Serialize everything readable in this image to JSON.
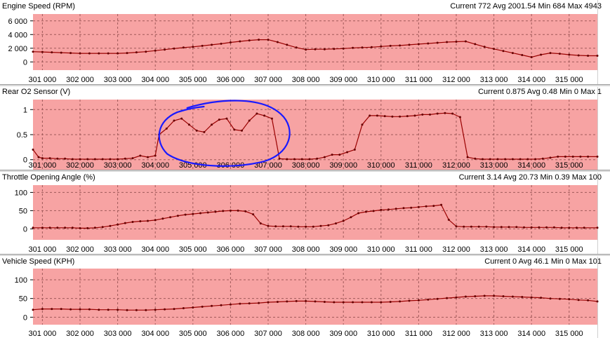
{
  "panels": [
    {
      "title": "Engine Speed (RPM)",
      "stats": "Current 772 Avg 2001.54 Min 684 Max 4943"
    },
    {
      "title": "Rear O2 Sensor (V)",
      "stats": "Current 0.875 Avg 0.48 Min 0 Max 1"
    },
    {
      "title": "Throttle Opening Angle (%)",
      "stats": "Current 3.14 Avg 20.73 Min 0.39 Max 100"
    },
    {
      "title": "Vehicle Speed (KPH)",
      "stats": "Current 0 Avg 46.1 Min 0 Max 101"
    }
  ],
  "colors": {
    "plot_background": "#f7a3a3",
    "line": "#990000",
    "marker": "#660000",
    "grid": "#a05a5a",
    "annotation": "#1a1aff"
  },
  "chart_data": [
    {
      "type": "line",
      "title": "Engine Speed (RPM)",
      "xlim": [
        300750,
        315750
      ],
      "ylim": [
        -1200,
        7000
      ],
      "y_ticks": [
        0,
        2000,
        4000,
        6000
      ],
      "y_tick_labels": [
        "0",
        "2 000",
        "4 000",
        "6 000"
      ],
      "x_ticks": [
        301000,
        302000,
        303000,
        304000,
        305000,
        306000,
        307000,
        308000,
        309000,
        310000,
        311000,
        312000,
        313000,
        314000,
        315000
      ],
      "x_tick_labels": [
        "301 000",
        "302 000",
        "303 000",
        "304 000",
        "305 000",
        "306 000",
        "307 000",
        "308 000",
        "309 000",
        "310 000",
        "311 000",
        "312 000",
        "313 000",
        "314 000",
        "315 000"
      ],
      "grid": true,
      "series": [
        {
          "x": [
            300750,
            301000,
            301250,
            301500,
            301750,
            302000,
            302250,
            302500,
            302750,
            303000,
            303250,
            303500,
            303750,
            304000,
            304250,
            304500,
            304750,
            305000,
            305250,
            305500,
            305750,
            306000,
            306250,
            306500,
            306750,
            307000,
            307250,
            307500,
            307750,
            308000,
            308250,
            308500,
            308750,
            309000,
            309250,
            309500,
            309750,
            310000,
            310250,
            310500,
            310750,
            311000,
            311250,
            311500,
            311750,
            312000,
            312250,
            312500,
            312750,
            313000,
            313250,
            313500,
            313750,
            314000,
            314250,
            314500,
            314750,
            315000,
            315250,
            315500,
            315750
          ],
          "y": [
            1500,
            1450,
            1400,
            1350,
            1300,
            1250,
            1250,
            1250,
            1250,
            1250,
            1300,
            1400,
            1500,
            1650,
            1800,
            1950,
            2100,
            2200,
            2350,
            2500,
            2650,
            2850,
            3000,
            3150,
            3250,
            3250,
            2900,
            2500,
            2100,
            1800,
            1850,
            1850,
            1900,
            1950,
            2050,
            2100,
            2150,
            2250,
            2350,
            2400,
            2500,
            2600,
            2700,
            2800,
            2900,
            2950,
            3000,
            2600,
            2200,
            1900,
            1600,
            1300,
            1000,
            700,
            1050,
            1300,
            1200,
            1050,
            950,
            900,
            900
          ]
        }
      ]
    },
    {
      "type": "line",
      "title": "Rear O2 Sensor (V)",
      "xlim": [
        300750,
        315750
      ],
      "ylim": [
        -0.2,
        1.2
      ],
      "y_ticks": [
        0,
        0.5,
        1
      ],
      "y_tick_labels": [
        "0",
        "0.5",
        "1"
      ],
      "x_ticks": [
        301000,
        302000,
        303000,
        304000,
        305000,
        306000,
        307000,
        308000,
        309000,
        310000,
        311000,
        312000,
        313000,
        314000,
        315000
      ],
      "x_tick_labels": [
        "301 000",
        "302 000",
        "303 000",
        "304 000",
        "305 000",
        "306 000",
        "307 000",
        "308 000",
        "309 000",
        "310 000",
        "311 000",
        "312 000",
        "313 000",
        "314 000",
        "315 000"
      ],
      "grid": true,
      "series": [
        {
          "x": [
            300750,
            300900,
            301000,
            301200,
            301400,
            301600,
            301800,
            302000,
            302200,
            302400,
            302600,
            302800,
            303000,
            303200,
            303400,
            303600,
            303800,
            304000,
            304100,
            304300,
            304500,
            304700,
            304900,
            305100,
            305300,
            305500,
            305700,
            305900,
            306100,
            306300,
            306500,
            306700,
            306900,
            307100,
            307300,
            307500,
            307700,
            307900,
            308100,
            308300,
            308500,
            308700,
            308900,
            309100,
            309300,
            309500,
            309700,
            309900,
            310100,
            310300,
            310500,
            310700,
            310900,
            311100,
            311300,
            311500,
            311700,
            311900,
            312100,
            312300,
            312500,
            312700,
            312900,
            313100,
            313300,
            313500,
            313700,
            313900,
            314100,
            314300,
            314500,
            314700,
            314900,
            315100,
            315300,
            315500,
            315750
          ],
          "y": [
            0.2,
            0.05,
            0.03,
            0.03,
            0.02,
            0.02,
            0.01,
            0.01,
            0.01,
            0.01,
            0.01,
            0.01,
            0.01,
            0.02,
            0.03,
            0.08,
            0.05,
            0.08,
            0.5,
            0.62,
            0.78,
            0.82,
            0.7,
            0.58,
            0.55,
            0.7,
            0.8,
            0.82,
            0.6,
            0.58,
            0.78,
            0.92,
            0.88,
            0.82,
            0.02,
            0.01,
            0.01,
            0.01,
            0.01,
            0.02,
            0.05,
            0.1,
            0.1,
            0.15,
            0.2,
            0.7,
            0.88,
            0.88,
            0.87,
            0.86,
            0.86,
            0.87,
            0.88,
            0.9,
            0.9,
            0.92,
            0.93,
            0.92,
            0.85,
            0.05,
            0.02,
            0.01,
            0.01,
            0.01,
            0.01,
            0.01,
            0.01,
            0.01,
            0.01,
            0.02,
            0.04,
            0.06,
            0.06,
            0.06,
            0.06,
            0.06,
            0.06
          ]
        }
      ],
      "annotations": [
        {
          "shape": "hand-drawn ellipse",
          "x_range": [
            304050,
            307600
          ],
          "y_range": [
            -0.15,
            1.18
          ]
        }
      ]
    },
    {
      "type": "line",
      "title": "Throttle Opening Angle (%)",
      "xlim": [
        300750,
        315750
      ],
      "ylim": [
        -30,
        120
      ],
      "y_ticks": [
        0,
        50,
        100
      ],
      "y_tick_labels": [
        "0",
        "50",
        "100"
      ],
      "x_ticks": [
        301000,
        302000,
        303000,
        304000,
        305000,
        306000,
        307000,
        308000,
        309000,
        310000,
        311000,
        312000,
        313000,
        314000,
        315000
      ],
      "x_tick_labels": [
        "301 000",
        "302 000",
        "303 000",
        "304 000",
        "305 000",
        "306 000",
        "307 000",
        "308 000",
        "309 000",
        "310 000",
        "311 000",
        "312 000",
        "313 000",
        "314 000",
        "315 000"
      ],
      "grid": true,
      "series": [
        {
          "x": [
            300750,
            301000,
            301200,
            301400,
            301600,
            301800,
            302000,
            302200,
            302400,
            302600,
            302800,
            303000,
            303200,
            303400,
            303600,
            303800,
            304000,
            304200,
            304400,
            304600,
            304800,
            305000,
            305200,
            305400,
            305600,
            305800,
            306000,
            306200,
            306400,
            306600,
            306800,
            307000,
            307200,
            307400,
            307600,
            307800,
            308000,
            308200,
            308400,
            308600,
            308800,
            309000,
            309200,
            309400,
            309600,
            309800,
            310000,
            310200,
            310400,
            310600,
            310800,
            311000,
            311200,
            311400,
            311600,
            311800,
            312000,
            312200,
            312400,
            312600,
            312800,
            313000,
            313200,
            313400,
            313600,
            313800,
            314000,
            314200,
            314400,
            314600,
            314800,
            315000,
            315200,
            315400,
            315750
          ],
          "y": [
            3,
            3,
            3,
            3,
            3,
            3,
            2,
            2,
            3,
            5,
            8,
            12,
            16,
            19,
            21,
            22,
            24,
            28,
            32,
            36,
            39,
            41,
            43,
            45,
            47,
            49,
            50,
            50,
            48,
            40,
            15,
            8,
            7,
            7,
            7,
            6,
            6,
            6,
            8,
            10,
            15,
            22,
            32,
            43,
            47,
            49,
            52,
            53,
            55,
            57,
            58,
            60,
            62,
            63,
            66,
            25,
            7,
            6,
            6,
            6,
            6,
            5,
            5,
            5,
            5,
            4,
            4,
            4,
            4,
            4,
            3,
            3,
            3,
            3,
            3
          ]
        }
      ]
    },
    {
      "type": "line",
      "title": "Vehicle Speed (KPH)",
      "xlim": [
        300750,
        315750
      ],
      "ylim": [
        -20,
        130
      ],
      "y_ticks": [
        0,
        50,
        100
      ],
      "y_tick_labels": [
        "0",
        "50",
        "100"
      ],
      "x_ticks": [
        301000,
        302000,
        303000,
        304000,
        305000,
        306000,
        307000,
        308000,
        309000,
        310000,
        311000,
        312000,
        313000,
        314000,
        315000
      ],
      "x_tick_labels": [
        "301 000",
        "302 000",
        "303 000",
        "304 000",
        "305 000",
        "306 000",
        "307 000",
        "308 000",
        "309 000",
        "310 000",
        "311 000",
        "312 000",
        "313 000",
        "314 000",
        "315 000"
      ],
      "grid": true,
      "series": [
        {
          "x": [
            300750,
            301000,
            301250,
            301500,
            301750,
            302000,
            302250,
            302500,
            302750,
            303000,
            303250,
            303500,
            303750,
            304000,
            304250,
            304500,
            304750,
            305000,
            305250,
            305500,
            305750,
            306000,
            306250,
            306500,
            306750,
            307000,
            307250,
            307500,
            307750,
            308000,
            308250,
            308500,
            308750,
            309000,
            309250,
            309500,
            309750,
            310000,
            310250,
            310500,
            310750,
            311000,
            311250,
            311500,
            311750,
            312000,
            312250,
            312500,
            312750,
            313000,
            313250,
            313500,
            313750,
            314000,
            314250,
            314500,
            314750,
            315000,
            315250,
            315500,
            315750
          ],
          "y": [
            20,
            22,
            22,
            22,
            21,
            21,
            21,
            20,
            20,
            20,
            19,
            19,
            19,
            20,
            21,
            22,
            24,
            26,
            28,
            30,
            32,
            34,
            36,
            37,
            38,
            40,
            41,
            42,
            43,
            43,
            42,
            41,
            40,
            40,
            40,
            40,
            40,
            40,
            41,
            42,
            44,
            45,
            47,
            49,
            51,
            53,
            55,
            56,
            57,
            57,
            56,
            55,
            54,
            53,
            52,
            50,
            49,
            48,
            46,
            45,
            42
          ]
        }
      ]
    }
  ]
}
